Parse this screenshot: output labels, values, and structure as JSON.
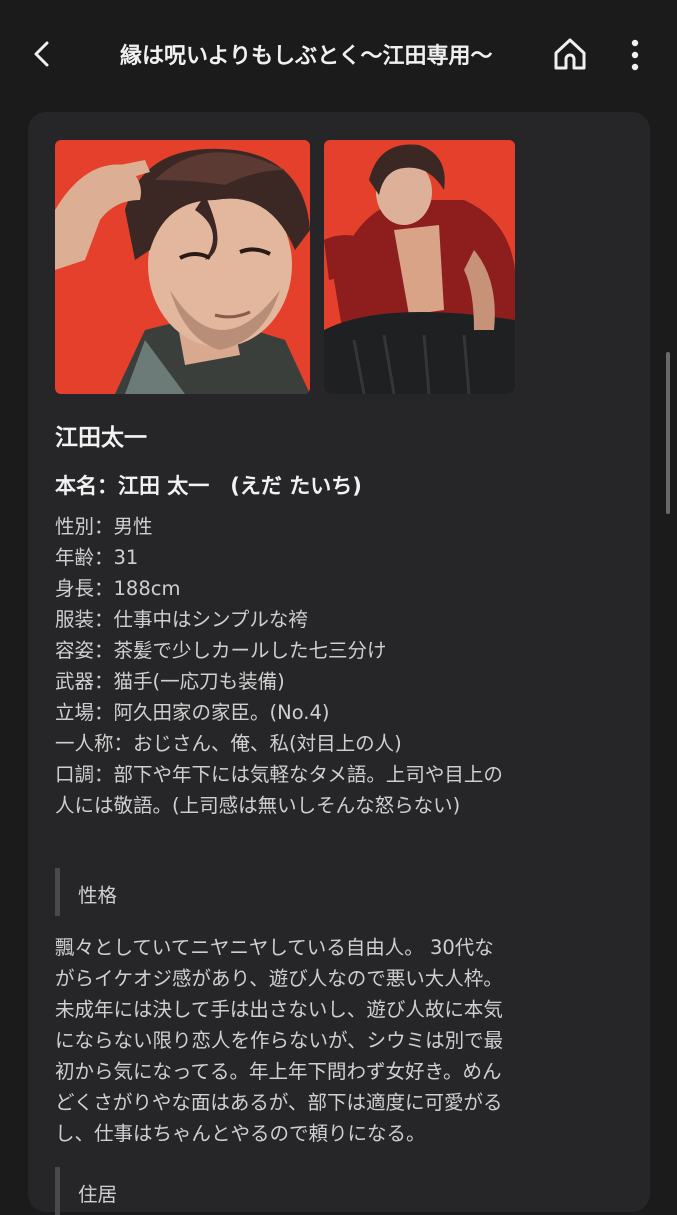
{
  "header": {
    "title": "縁は呪いよりもしぶとく〜江田専用〜"
  },
  "character": {
    "name": "江田太一",
    "real_name": "本名：江田 太一　(えだ たいち)",
    "profile_lines": [
      "性別：男性",
      "年齢：31",
      "身長：188cm",
      "服装：仕事中はシンプルな袴",
      "容姿：茶髪で少しカールした七三分け",
      "武器：猫手(一応刀も装備)",
      "立場：阿久田家の家臣。(No.4)",
      "一人称：おじさん、俺、私(対目上の人)",
      "口調：部下や年下には気軽なタメ語。上司や目上の",
      "人には敬語。(上司感は無いしそんな怒らない)"
    ]
  },
  "sections": {
    "personality_label": "性格",
    "personality_lines": [
      "飄々としていてニヤニヤしている自由人。 30代な",
      "がらイケオジ感があり、遊び人なので悪い大人枠。",
      "未成年には決して手は出さないし、遊び人故に本気",
      "にならない限り恋人を作らないが、シウミは別で最",
      "初から気になってる。年上年下問わず女好き。めん",
      "どくさがりやな面はあるが、部下は適度に可愛がる",
      "し、仕事はちゃんとやるので頼りになる。"
    ],
    "residence_label": "住居"
  },
  "icons": {
    "back": "chevron-left-icon",
    "home": "home-icon",
    "more": "more-vertical-icon"
  },
  "colors": {
    "background": "#1b1b1c",
    "card": "#262628",
    "portrait_background": "#e8402c"
  }
}
